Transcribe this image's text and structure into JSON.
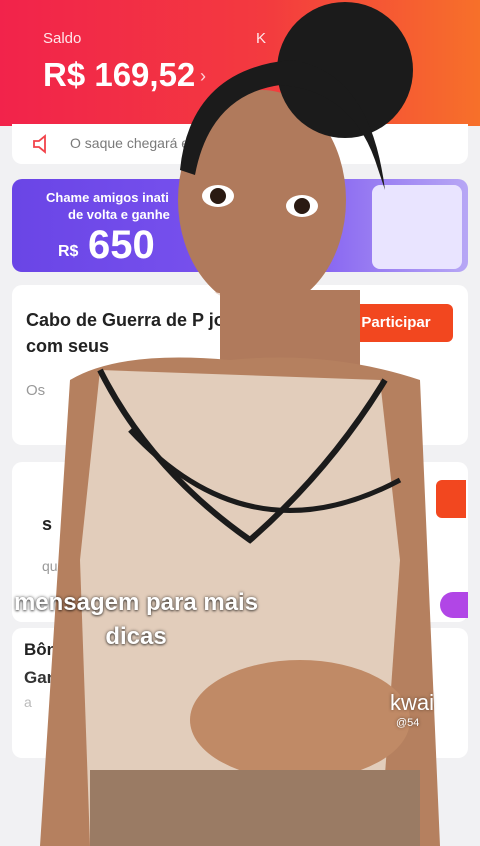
{
  "header": {
    "saldo_label": "Saldo",
    "saldo_value": "R$ 169,52",
    "chevron": "›",
    "k_label": "K"
  },
  "notice": {
    "icon": "speaker-icon",
    "text": "O saque chegará e"
  },
  "banner": {
    "line1": "Chame amigos inati",
    "line2": "de volta e ganhe",
    "currency": "R$",
    "amount": "650"
  },
  "task_card": {
    "title": "Cabo de Guerra de P jogar com seus",
    "action_label": "Participar",
    "subtitle": "Os"
  },
  "second_card": {
    "title_fragment": "s",
    "subtitle": "que p"
  },
  "bonus_card": {
    "title": "Bônus",
    "subtitle": "Ganhe",
    "detail": "a"
  },
  "video_overlay": {
    "caption_line1": "mensagem para mais",
    "caption_line2": "dicas",
    "watermark": "kwai",
    "watermark_id": "@54"
  },
  "colors": {
    "header_start": "#f2234b",
    "header_end": "#f7702a",
    "banner": "#6a45e6",
    "action": "#f2471f"
  }
}
